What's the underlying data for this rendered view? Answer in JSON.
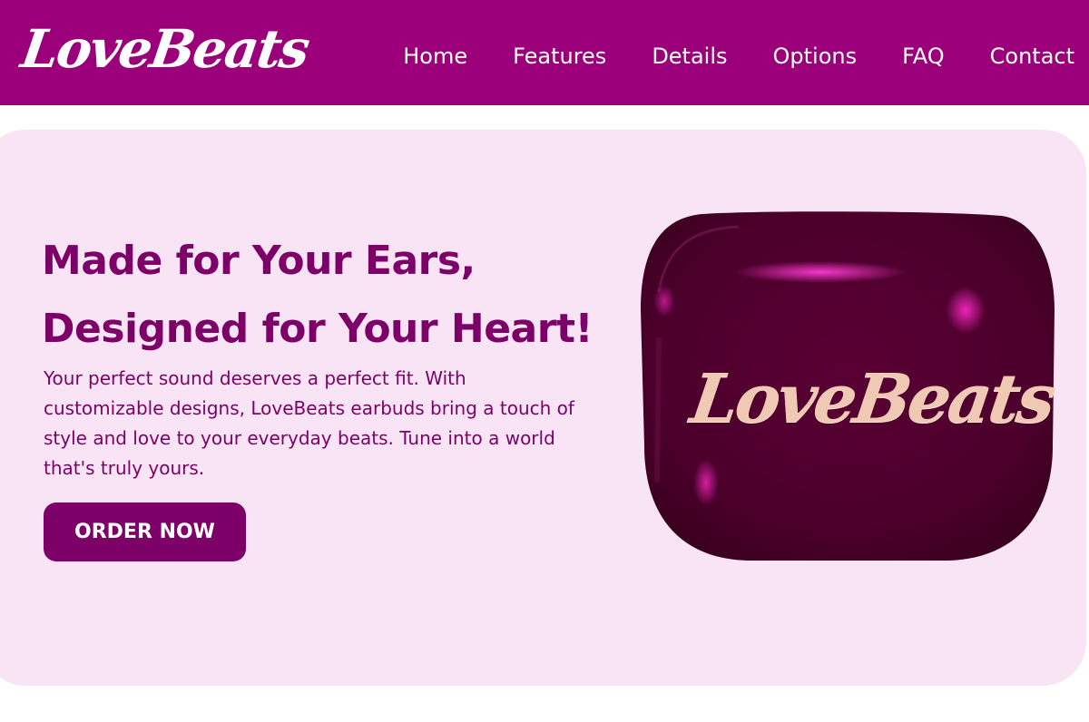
{
  "brand": {
    "name": "LoveBeats"
  },
  "nav": {
    "items": [
      {
        "label": "Home"
      },
      {
        "label": "Features"
      },
      {
        "label": "Details"
      },
      {
        "label": "Options"
      },
      {
        "label": "FAQ"
      },
      {
        "label": "Contact"
      }
    ]
  },
  "hero": {
    "headline_line1": "Made for Your Ears,",
    "headline_line2": "Designed for Your Heart!",
    "body": "Your perfect sound deserves a perfect fit. With customizable designs, LoveBeats earbuds bring a touch of style and love to your everyday beats. Tune into a world that's truly yours.",
    "cta_label": "ORDER NOW"
  },
  "product": {
    "case_logo_text": "LoveBeats"
  },
  "colors": {
    "nav_background": "#9b007a",
    "hero_background": "#f8e4f4",
    "accent_dark": "#7d0068",
    "case_color": "#4a0028",
    "case_highlight": "#ff2fd0",
    "case_logo_gold": "#f0c9b4"
  },
  "icons": {
    "logo": "lovebeats-script-logo"
  }
}
